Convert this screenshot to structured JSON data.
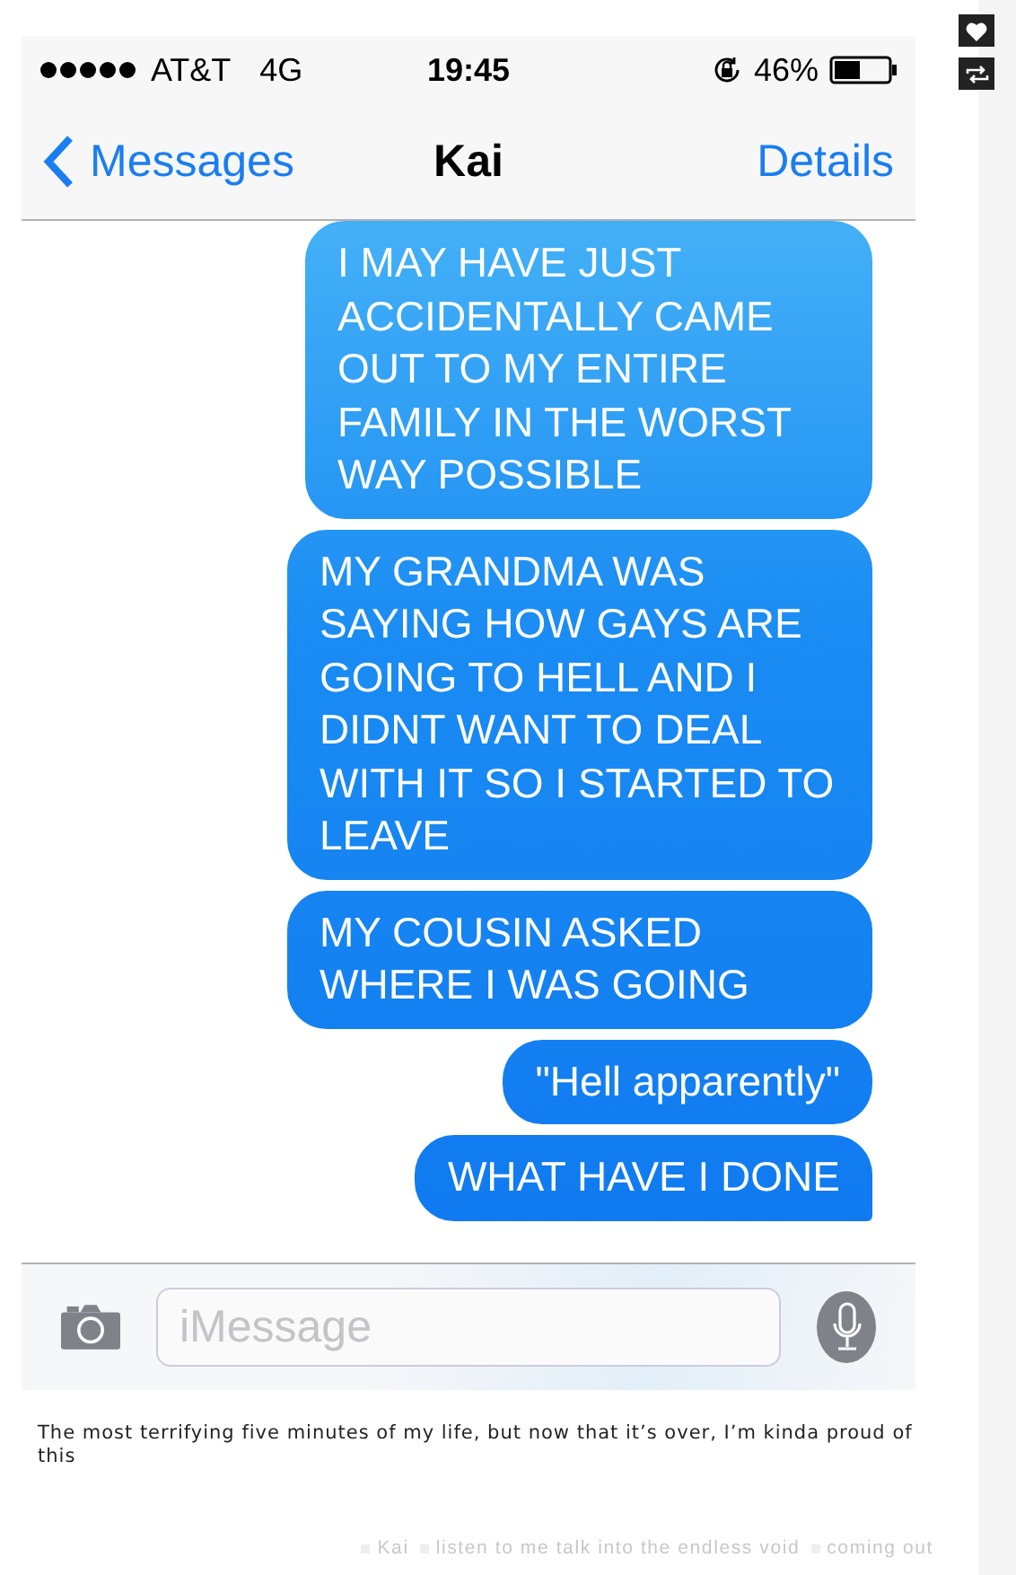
{
  "status_bar": {
    "carrier": "AT&T",
    "network": "4G",
    "time": "19:45",
    "battery": "46%"
  },
  "nav": {
    "back": "Messages",
    "title": "Kai",
    "action": "Details"
  },
  "messages": [
    {
      "text": "I MAY HAVE JUST ACCIDENTALLY CAME OUT TO MY ENTIRE FAMILY IN THE WORST WAY POSSIBLE",
      "tail": false
    },
    {
      "text": "MY GRANDMA WAS SAYING HOW GAYS ARE GOING TO HELL AND I DIDNT WANT TO DEAL WITH IT SO I STARTED TO LEAVE",
      "tail": false
    },
    {
      "text": "MY COUSIN ASKED WHERE I WAS GOING",
      "tail": false
    },
    {
      "text": "\"Hell apparently\"",
      "tail": false
    },
    {
      "text": "WHAT HAVE I DONE",
      "tail": true
    }
  ],
  "composer": {
    "placeholder": "iMessage"
  },
  "caption": "The most terrifying five minutes of my life, but now that it’s over, I’m kinda proud of this",
  "tags": [
    "Kai",
    "listen to me talk into the endless void",
    "coming out"
  ]
}
